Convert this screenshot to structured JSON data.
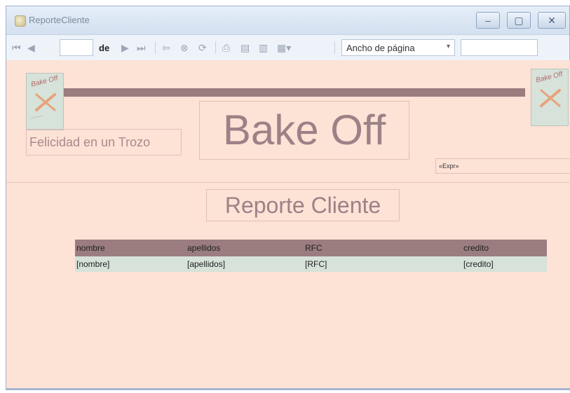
{
  "window": {
    "title": "ReporteCliente",
    "controls": {
      "minimize": "–",
      "maximize": "▢",
      "close": "✕"
    }
  },
  "toolbar": {
    "page_label": "de",
    "zoom_value": "Ancho de página",
    "icons": [
      "first-page",
      "previous-page",
      "next-page",
      "last-page",
      "back",
      "stop",
      "refresh",
      "print",
      "print-layout",
      "page-setup",
      "export"
    ]
  },
  "report": {
    "brand": "Bake Off",
    "slogan": "Felicidad en un Trozo",
    "expression": "«Expr»",
    "title": "Reporte Cliente",
    "logo_text": "Bake Off",
    "table": {
      "headers": [
        "nombre",
        "apellidos",
        "RFC",
        "credito"
      ],
      "row": [
        "[nombre]",
        "[apellidos]",
        "[RFC]",
        "[credito]"
      ]
    },
    "colors": {
      "background": "#fde2d6",
      "band": "#9b7d7f",
      "data_row": "#d6e2da"
    }
  }
}
